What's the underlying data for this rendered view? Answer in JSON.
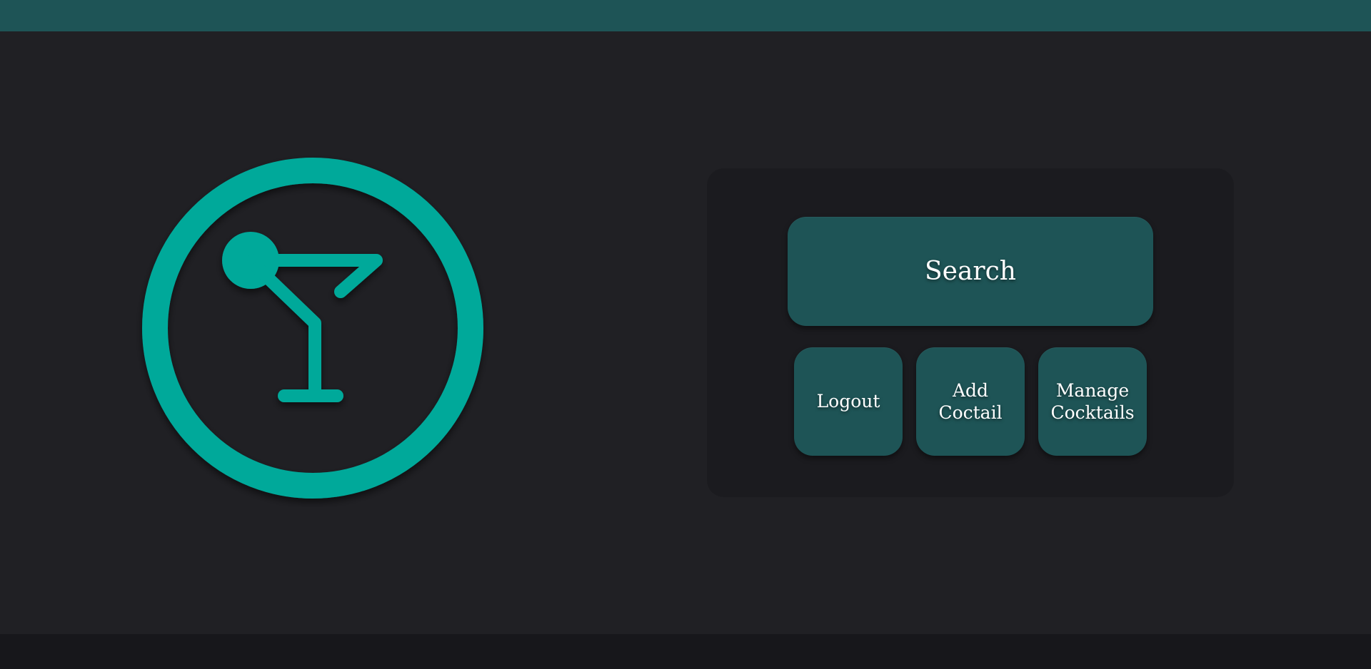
{
  "header": {},
  "logo": {
    "icon": "cocktail-glass-icon",
    "color": "#00a99a"
  },
  "menu": {
    "search_label": "Search",
    "logout_label": "Logout",
    "add_label": "Add\nCoctail",
    "manage_label": "Manage\nCocktails"
  },
  "colors": {
    "accent": "#00a99a",
    "button_bg": "#1e5456",
    "page_bg": "#202024",
    "panel_bg": "#1b1b1f"
  }
}
